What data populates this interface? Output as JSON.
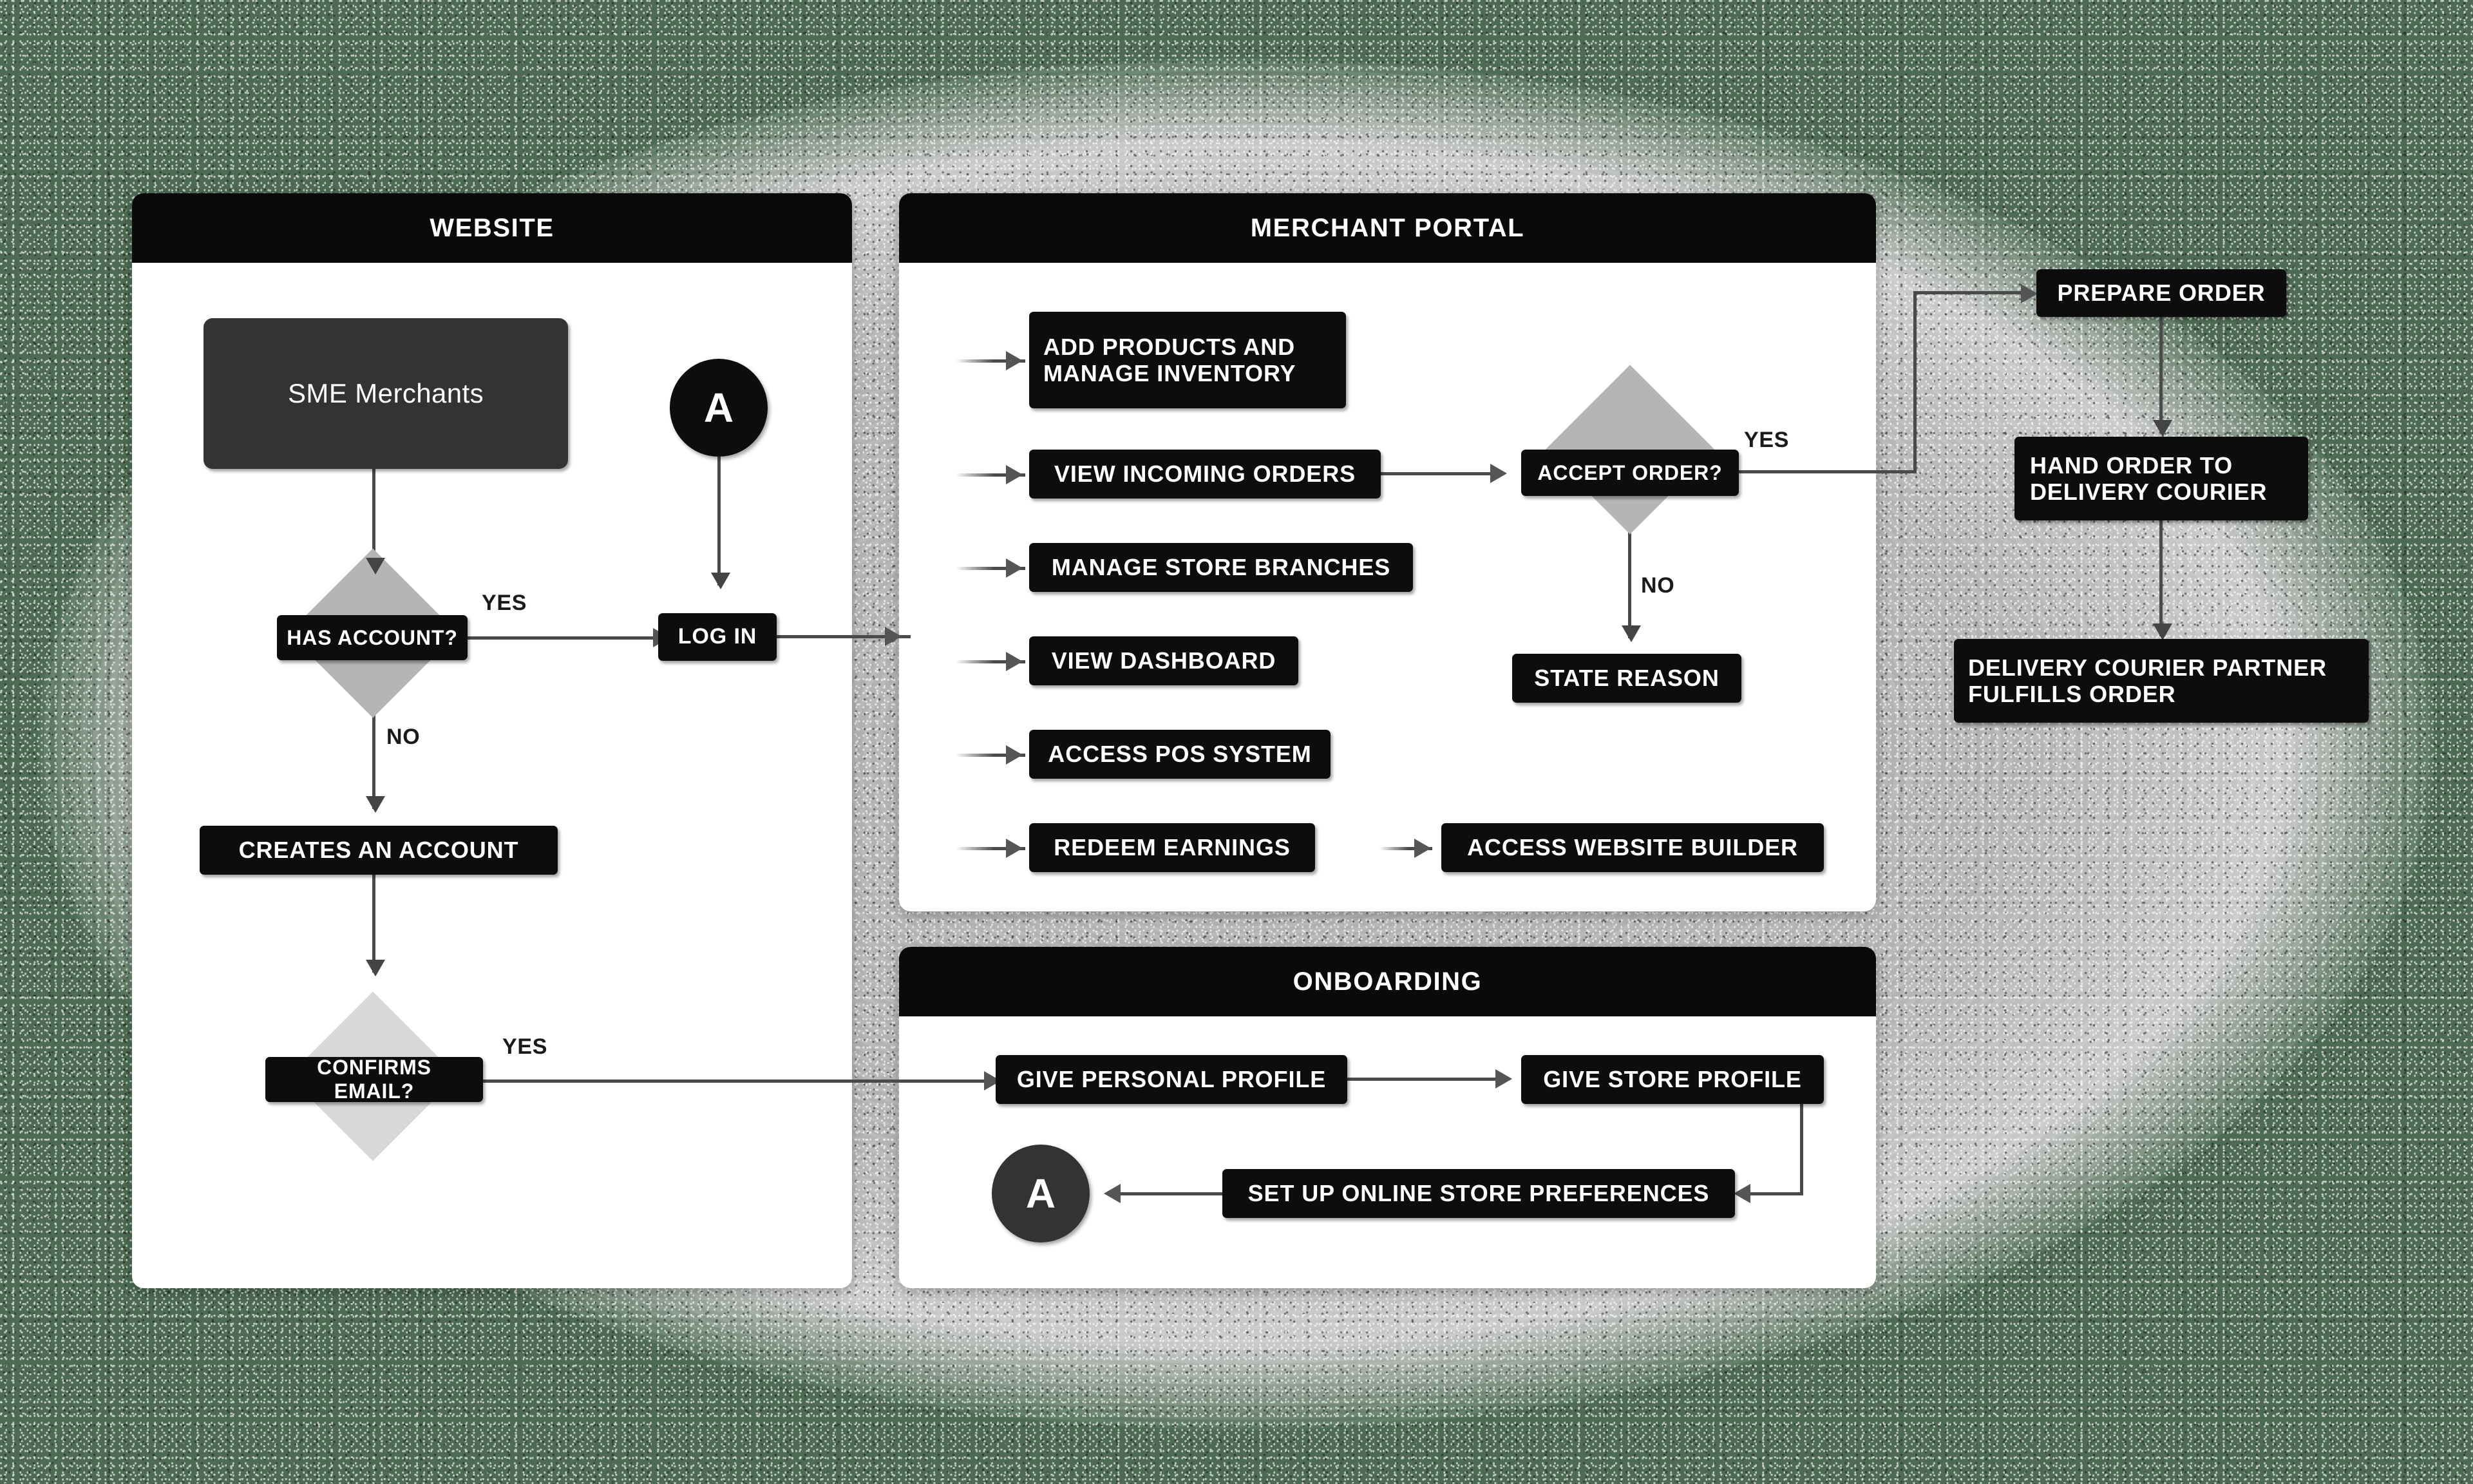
{
  "theme": {
    "background_green": "#4c6b52",
    "disc_gray": "#b2b2b2",
    "panel_bg": "#ffffff",
    "node_black": "#0d0d0d",
    "node_soft_gray": "#333333",
    "diamond_gray": "#b5b5b5",
    "diamond_light_gray": "#d8d8d8",
    "connector_gray": "#4a4a4a"
  },
  "panels": {
    "website": {
      "title": "WEBSITE"
    },
    "merchant_portal": {
      "title": "MERCHANT PORTAL"
    },
    "onboarding": {
      "title": "ONBOARDING"
    }
  },
  "website": {
    "start_node": "SME Merchants",
    "connector_a": "A",
    "decision_has_account": "HAS ACCOUNT?",
    "has_account_yes": "YES",
    "has_account_no": "NO",
    "log_in": "LOG IN",
    "creates_account": "CREATES AN ACCOUNT",
    "decision_confirms_email": "CONFIRMS EMAIL?",
    "confirms_email_yes": "YES"
  },
  "merchant_portal": {
    "items": [
      "ADD PRODUCTS AND MANAGE INVENTORY",
      "VIEW INCOMING ORDERS",
      "MANAGE STORE BRANCHES",
      "VIEW DASHBOARD",
      "ACCESS POS SYSTEM",
      "REDEEM EARNINGS"
    ],
    "item_lines": {
      "add_products_line1": "ADD PRODUCTS AND",
      "add_products_line2": "MANAGE INVENTORY"
    },
    "decision_accept_order": "ACCEPT ORDER?",
    "accept_order_yes": "YES",
    "accept_order_no": "NO",
    "state_reason": "STATE REASON",
    "access_website_builder": "ACCESS WEBSITE BUILDER"
  },
  "fulfillment": {
    "prepare_order": "PREPARE ORDER",
    "hand_order_line1": "HAND ORDER TO",
    "hand_order_line2": "DELIVERY COURIER",
    "fulfills_line1": "DELIVERY COURIER PARTNER",
    "fulfills_line2": "FULFILLS ORDER"
  },
  "onboarding": {
    "give_personal_profile": "GIVE PERSONAL PROFILE",
    "give_store_profile": "GIVE STORE PROFILE",
    "set_up_preferences": "SET UP ONLINE STORE PREFERENCES",
    "connector_a": "A"
  }
}
